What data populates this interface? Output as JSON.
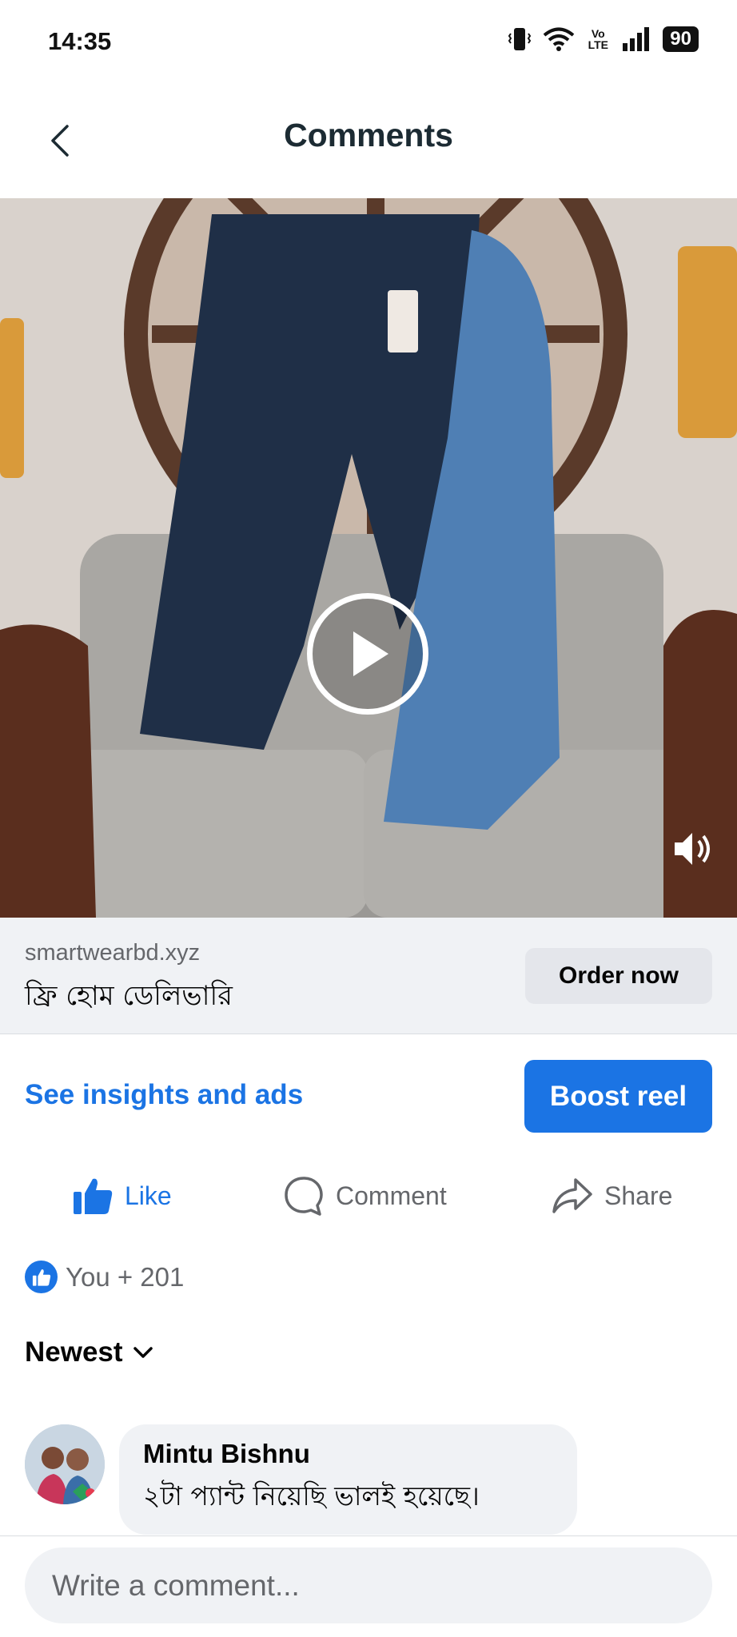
{
  "status_bar": {
    "time": "14:35",
    "network_label": "Vo LTE",
    "battery": "90"
  },
  "header": {
    "title": "Comments"
  },
  "cta": {
    "domain": "smartwearbd.xyz",
    "text": "ফ্রি হোম ডেলিভারি",
    "button": "Order now"
  },
  "insights": {
    "link": "See insights and ads",
    "boost_button": "Boost reel"
  },
  "actions": {
    "like": "Like",
    "comment": "Comment",
    "share": "Share"
  },
  "reactions": {
    "summary": "You + 201"
  },
  "sort": {
    "label": "Newest"
  },
  "comments": [
    {
      "author": "Mintu Bishnu",
      "text": "২টা প্যান্ট নিয়েছি ভালই হয়েছে।"
    }
  ],
  "composer": {
    "placeholder": "Write a comment..."
  },
  "colors": {
    "accent": "#1b74e4",
    "secondary_text": "#65676b",
    "surface": "#f0f2f5"
  },
  "icons": [
    "vibrate-icon",
    "wifi-icon",
    "signal-icon",
    "battery-icon",
    "back-arrow-icon",
    "play-icon",
    "sound-icon",
    "like-icon",
    "comment-icon",
    "share-icon",
    "chevron-down-icon"
  ]
}
